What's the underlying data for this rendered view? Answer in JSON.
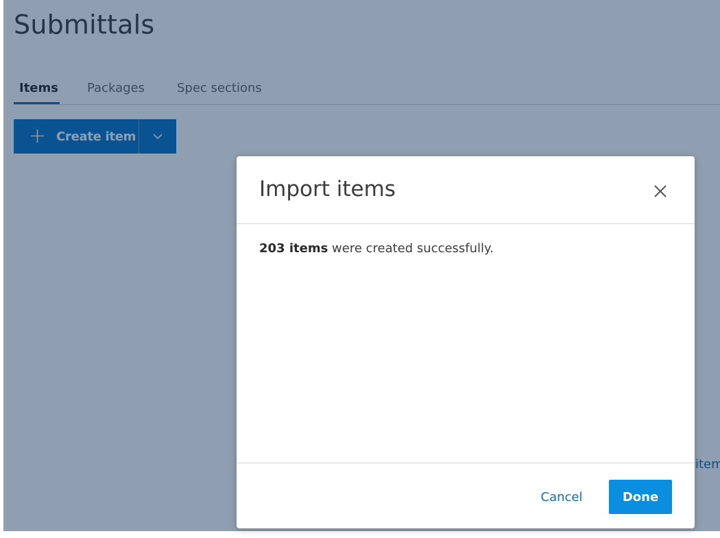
{
  "app": {
    "title": "Submittals",
    "tabs": [
      {
        "label": "Items",
        "active": true
      },
      {
        "label": "Packages",
        "active": false
      },
      {
        "label": "Spec sections",
        "active": false
      }
    ],
    "create_button_label": "Create item",
    "side_link_text": "item"
  },
  "modal": {
    "title": "Import items",
    "message_bold": "203 items",
    "message_rest": " were created successfully.",
    "cancel_label": "Cancel",
    "done_label": "Done"
  },
  "colors": {
    "primary": "#0874c6",
    "done_button": "#0a8fe0",
    "overlay": "rgba(10, 45, 85, 0.46)"
  },
  "icons": {
    "plus": "plus-icon",
    "chevron": "chevron-down-icon",
    "close": "close-icon"
  }
}
